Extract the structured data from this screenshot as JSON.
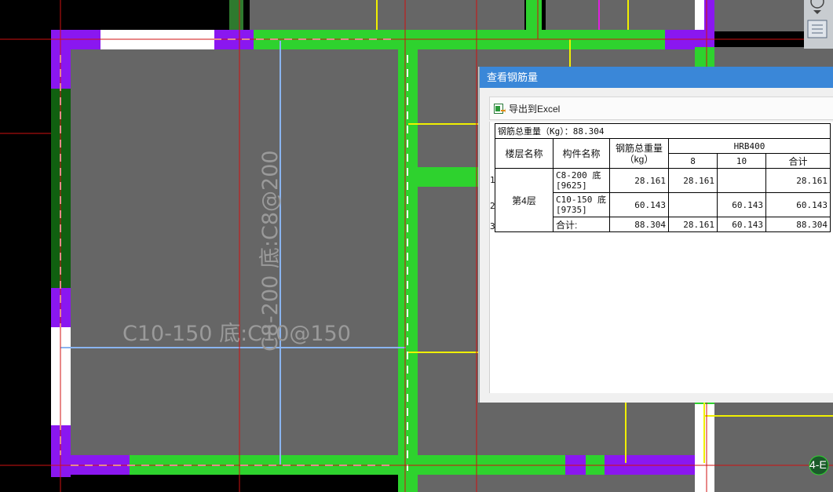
{
  "canvas": {
    "labels": {
      "horizontal_slab": "C10-150 底:C10@150",
      "vertical_slab": "C8-200 底:C8@200",
      "axis_tag": "4-E"
    },
    "colors": {
      "background": "#000000",
      "slab": "#666666",
      "beam_green": "#2ed22e",
      "column_purple": "#8a17f0",
      "grid_red": "#d01010",
      "rebar_blue": "#8ab4f0",
      "yellow_line": "#f0f000"
    }
  },
  "dialog": {
    "title": "查看钢筋量",
    "toolbar": {
      "export_label": "导出到Excel"
    },
    "total_line": "钢筋总重量（Kg）：88.304",
    "table": {
      "headers": {
        "floor": "楼层名称",
        "component": "构件名称",
        "total_weight": "钢筋总重量（kg）",
        "grade": "HRB400",
        "d8": "8",
        "d10": "10",
        "sum": "合计"
      },
      "floor_name": "第4层",
      "rows": [
        {
          "num": "1",
          "component": "C8-200 底[9625]",
          "total": "28.161",
          "d8": "28.161",
          "d10": "",
          "sum": "28.161"
        },
        {
          "num": "2",
          "component": "C10-150 底[9735]",
          "total": "60.143",
          "d8": "",
          "d10": "60.143",
          "sum": "60.143"
        },
        {
          "num": "3",
          "component": "合计:",
          "total": "88.304",
          "d8": "28.161",
          "d10": "60.143",
          "sum": "88.304"
        }
      ]
    }
  }
}
